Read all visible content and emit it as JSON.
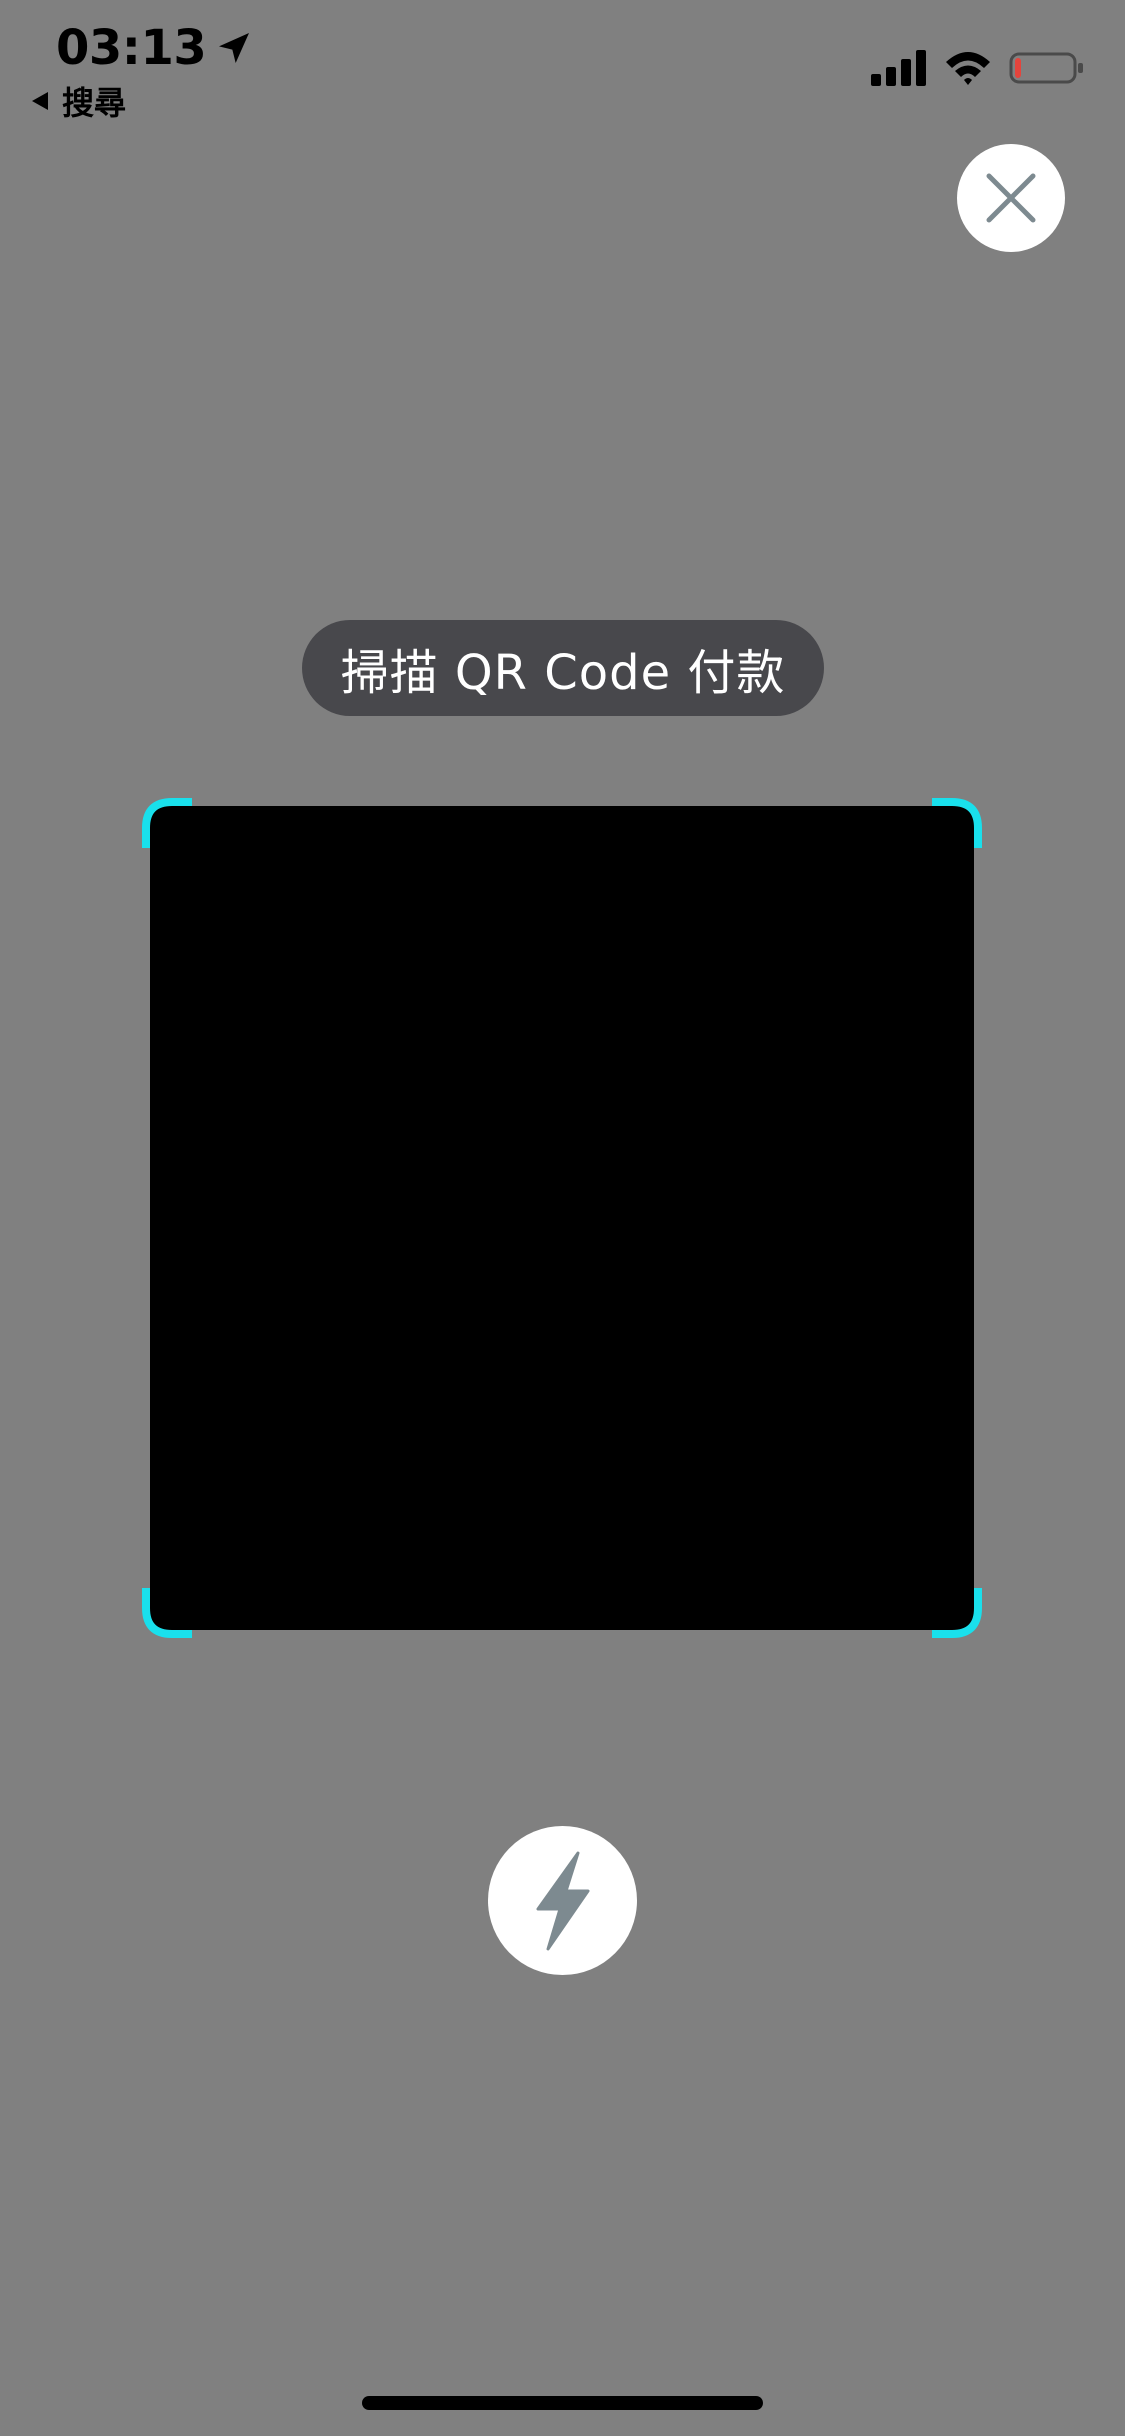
{
  "status_bar": {
    "time": "03:13",
    "back_label": "搜尋",
    "location_icon": "location-arrow-icon",
    "signal_icon": "cellular-signal-icon",
    "wifi_icon": "wifi-icon",
    "battery_icon": "battery-low-icon",
    "battery_level": 0.1,
    "battery_color": "#e5443c"
  },
  "scanner": {
    "hint": "掃描 QR Code 付款",
    "corner_color": "#19e0ec",
    "close_icon": "close-icon",
    "flash_icon": "flash-icon"
  },
  "colors": {
    "background": "#808080",
    "pill_background": "#48484c",
    "icon_gray": "#7d8a90"
  }
}
